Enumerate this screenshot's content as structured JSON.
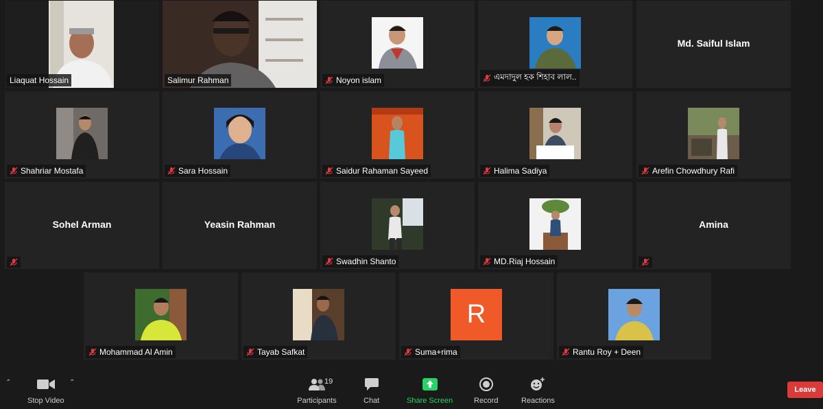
{
  "participants": [
    {
      "name": "Liaquat Hossain",
      "type": "full",
      "muted": false
    },
    {
      "name": "Salimur Rahman",
      "type": "full",
      "muted": false,
      "active": true
    },
    {
      "name": "Noyon islam",
      "type": "photo",
      "muted": true
    },
    {
      "name": "এমদাদুল হক শিহাব লাল..",
      "type": "photo",
      "muted": true
    },
    {
      "name": "Md. Saiful Islam",
      "type": "name",
      "muted": false
    },
    {
      "name": "Shahriar Mostafa",
      "type": "photo",
      "muted": true
    },
    {
      "name": "Sara Hossain",
      "type": "photo",
      "muted": true
    },
    {
      "name": "Saidur Rahaman Sayeed",
      "type": "photo",
      "muted": true
    },
    {
      "name": "Halima Sadiya",
      "type": "photo",
      "muted": true
    },
    {
      "name": "Arefin Chowdhury Rafi",
      "type": "photo",
      "muted": true
    },
    {
      "name": "Sohel Arman",
      "type": "name",
      "muted": true
    },
    {
      "name": "Yeasin Rahman",
      "type": "name",
      "muted": false
    },
    {
      "name": "Swadhin Shanto",
      "type": "photo",
      "muted": true
    },
    {
      "name": "MD.Riaj Hossain",
      "type": "photo",
      "muted": true
    },
    {
      "name": "Amina",
      "type": "name",
      "muted": true
    },
    {
      "name": "Mohammad Al Amin",
      "type": "photo",
      "muted": true
    },
    {
      "name": "Tayab Safkat",
      "type": "photo",
      "muted": true
    },
    {
      "name": "Suma+rima",
      "type": "letter",
      "letter": "R",
      "muted": true
    },
    {
      "name": "Rantu Roy + Deen",
      "type": "photo",
      "muted": true
    }
  ],
  "toolbar": {
    "stop_video": "Stop Video",
    "participants": "Participants",
    "participants_count": "19",
    "chat": "Chat",
    "share_screen": "Share Screen",
    "record": "Record",
    "reactions": "Reactions",
    "leave": "Leave"
  },
  "colors": {
    "background": "#1a1a1a",
    "tile": "#232323",
    "active_border": "#f3f08a",
    "share_green": "#25d366",
    "leave_red": "#d93b3b",
    "letter_avatar": "#f05a28",
    "mute_red": "#e0393e"
  }
}
